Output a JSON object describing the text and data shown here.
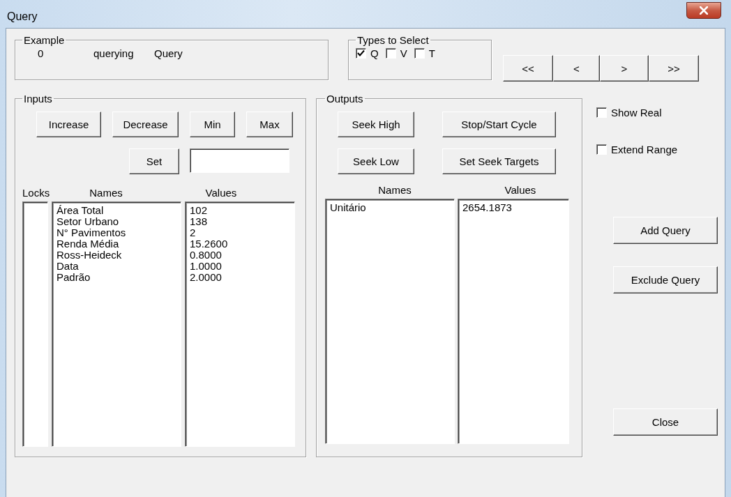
{
  "window": {
    "title": "Query"
  },
  "example": {
    "legend": "Example",
    "fields": [
      "0",
      "querying",
      "Query"
    ]
  },
  "types": {
    "legend": "Types to Select",
    "options": [
      {
        "label": "Q",
        "checked": true
      },
      {
        "label": "V",
        "checked": false
      },
      {
        "label": "T",
        "checked": false
      }
    ]
  },
  "nav_buttons": [
    "<<",
    "<",
    ">",
    ">>"
  ],
  "inputs": {
    "legend": "Inputs",
    "buttons": [
      "Increase",
      "Decrease",
      "Min",
      "Max"
    ],
    "set_button": "Set",
    "columns": [
      "Locks",
      "Names",
      "Values"
    ],
    "rows": [
      {
        "name": "Área Total",
        "value": "102"
      },
      {
        "name": "Setor Urbano",
        "value": "138"
      },
      {
        "name": "N° Pavimentos",
        "value": "2"
      },
      {
        "name": "Renda Média",
        "value": "15.2600"
      },
      {
        "name": "Ross-Heideck",
        "value": "0.8000"
      },
      {
        "name": "Data",
        "value": "1.0000"
      },
      {
        "name": "Padrão",
        "value": "2.0000"
      }
    ]
  },
  "outputs": {
    "legend": "Outputs",
    "buttons": [
      "Seek High",
      "Stop/Start Cycle",
      "Seek Low",
      "Set Seek Targets"
    ],
    "columns": [
      "Names",
      "Values"
    ],
    "rows": [
      {
        "name": "Unitário",
        "value": "2654.1873"
      }
    ]
  },
  "options": [
    {
      "label": "Show Real",
      "checked": false
    },
    {
      "label": "Extend Range",
      "checked": false
    }
  ],
  "actions": [
    "Add Query",
    "Exclude Query",
    "Close"
  ]
}
